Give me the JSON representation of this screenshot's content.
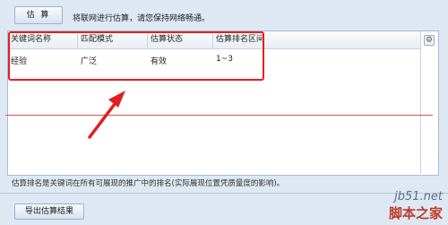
{
  "toolbar": {
    "estimate_button": "估 算",
    "tip": "将联网进行估算，请您保持网络畅通。"
  },
  "table": {
    "columns": [
      "关键词名称",
      "匹配模式",
      "估算状态",
      "估算排名区间"
    ],
    "rows": [
      [
        "经验",
        "广泛",
        "有效",
        "1~3"
      ]
    ]
  },
  "note": "估算排名是关键词在所有可展现的推广中的排名(实际展现位置凭质量度的影响)。",
  "export_button": "导出估算结果",
  "watermark": {
    "url": "jb51.net",
    "name": "脚本之家"
  },
  "annotation": {
    "color": "#e02020"
  }
}
